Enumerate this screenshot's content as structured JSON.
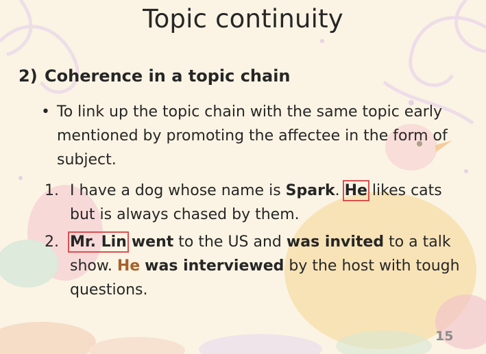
{
  "slide": {
    "title": "Topic continuity",
    "heading_number": "2)",
    "heading_text": "Coherence in a topic chain",
    "bullet_symbol": "•",
    "bullet_text": "To link up the topic chain with the same topic early mentioned by promoting the affectee in the form of subject.",
    "examples": [
      {
        "number": "1.",
        "parts": [
          "I have a dog whose name is ",
          "Spark",
          ". ",
          "He",
          " likes cats but is always chased by them."
        ]
      },
      {
        "number": "2.",
        "parts": [
          "Mr. Lin",
          " ",
          "went",
          " to the US and ",
          "was invited",
          " to a talk show. ",
          "He",
          " ",
          "was interviewed",
          " by the host with tough questions."
        ]
      }
    ],
    "page_number": "15"
  },
  "colors": {
    "background": "#fbf4e4",
    "text": "#262626",
    "highlight_pronoun": "#a6612b",
    "box_outline": "#d9504f",
    "page_number": "#8c8c8c"
  }
}
